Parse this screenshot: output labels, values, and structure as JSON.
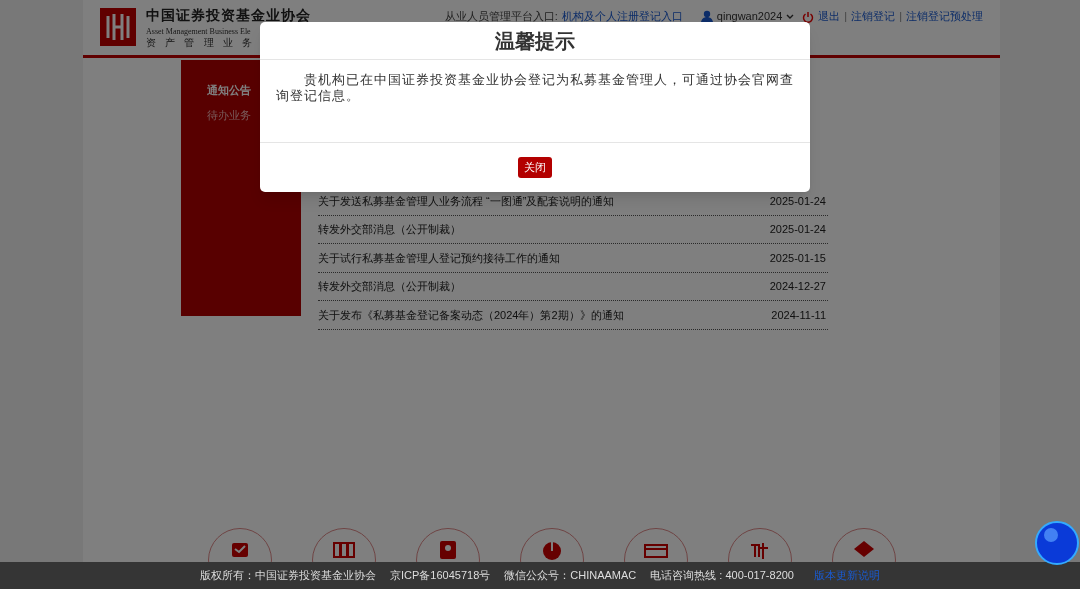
{
  "header": {
    "org_name": "中国证券投资基金业协会",
    "org_name_en": "Asset Management Business Ele",
    "org_tagline": "资 产 管 理 业 务",
    "portal_label": "从业人员管理平台入口:",
    "portal_link": "机构及个人注册登记入口",
    "username": "qingwan2024",
    "links": [
      "退出",
      "注销登记",
      "注销登记预处理"
    ],
    "separator": "|"
  },
  "sidebar": {
    "items": [
      {
        "label": "通知公告",
        "selected": true
      },
      {
        "label": "待办业务",
        "selected": false
      }
    ]
  },
  "notices": [
    {
      "title": "关于发送私募基金管理人业务流程 “一图通”及配套说明的通知",
      "date": "2025-01-24"
    },
    {
      "title": "转发外交部消息（公开制裁）",
      "date": "2025-01-24"
    },
    {
      "title": "关于试行私募基金管理人登记预约接待工作的通知",
      "date": "2025-01-15"
    },
    {
      "title": "转发外交部消息（公开制裁）",
      "date": "2024-12-27"
    },
    {
      "title": "关于发布《私募基金登记备案动态（2024年）第2期）》的通知",
      "date": "2024-11-11"
    }
  ],
  "footer": {
    "items": [
      "版权所有：中国证券投资基金业协会",
      "京ICP备16045718号",
      "微信公众号：CHINAAMAC",
      "电话咨询热线 : 400-017-8200"
    ],
    "link": "版本更新说明"
  },
  "dialog": {
    "title": "温馨提示",
    "message": "贵机构已在中国证券投资基金业协会登记为私募基金管理人，可通过协会官网查询登记信息。",
    "button": "关闭"
  }
}
